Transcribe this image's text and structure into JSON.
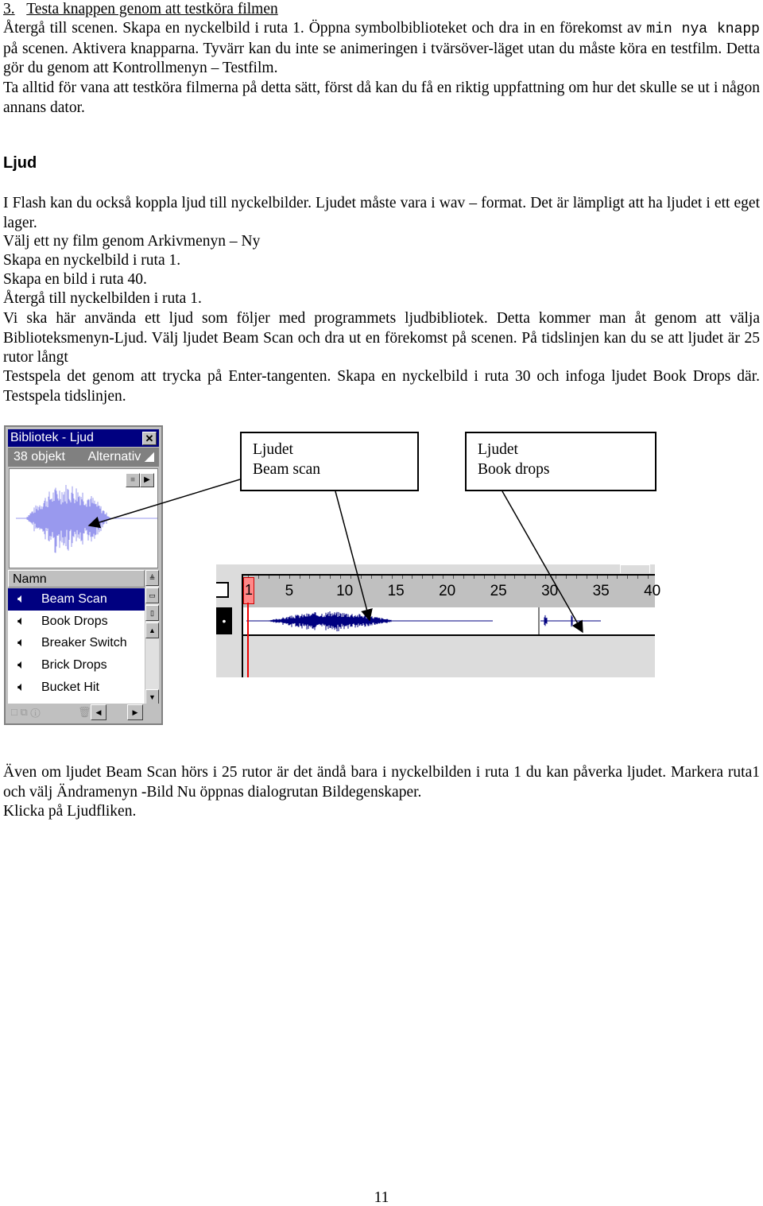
{
  "section": {
    "number": "3.",
    "title": "Testa knappen genom att testköra filmen"
  },
  "intro": {
    "p1_a": "Återgå till scenen. Skapa en nyckelbild i ruta 1. Öppna symbolbiblioteket och dra in en förekomst av",
    "p1_code": "min nya knapp",
    "p1_b": "på scenen. Aktivera knapparna. Tyvärr kan du inte se animeringen i tvärsöver-läget utan du måste köra en testfilm. Detta gör du genom att Kontrollmenyn – Testfilm.",
    "p2": "Ta alltid för vana att testköra filmerna på detta sätt, först då kan du få en riktig uppfattning om hur det skulle se ut i någon annans dator."
  },
  "heading": "Ljud",
  "body": {
    "p1": "I Flash kan du också koppla ljud till nyckelbilder. Ljudet måste vara i wav – format. Det är lämpligt att ha ljudet i ett eget lager.",
    "l1": "Välj ett ny film genom Arkivmenyn – Ny",
    "l2": "Skapa en nyckelbild i ruta 1.",
    "l3": "Skapa en bild i ruta 40.",
    "l4": "Återgå till nyckelbilden i ruta 1.",
    "p2": "Vi ska här använda ett ljud som följer med programmets ljudbibliotek. Detta kommer man åt genom att välja Biblioteksmenyn-Ljud. Välj ljudet Beam Scan och dra ut en förekomst på scenen. På tidslinjen kan du se att ljudet är 25 rutor långt",
    "p3": "Testspela det genom att trycka på Enter-tangenten. Skapa en nyckelbild i ruta 30 och infoga ljudet Book Drops där. Testspela tidslinjen."
  },
  "library": {
    "title": "Bibliotek - Ljud",
    "count": "38 objekt",
    "options": "Alternativ",
    "column": "Namn",
    "items": [
      "Beam Scan",
      "Book Drops",
      "Breaker Switch",
      "Brick Drops",
      "Bucket Hit"
    ],
    "selected": "Beam Scan",
    "waveform_color": "#9999ee"
  },
  "callouts": [
    {
      "line1": "Ljudet",
      "line2": "Beam scan"
    },
    {
      "line1": "Ljudet",
      "line2": "Book drops"
    }
  ],
  "timeline": {
    "current_frame": "1",
    "ticks": [
      "5",
      "10",
      "15",
      "20",
      "25",
      "30",
      "35",
      "40"
    ],
    "waveform_color": "#000080"
  },
  "outro": {
    "p1": "Även om ljudet Beam Scan hörs i 25 rutor är det ändå bara i nyckelbilden i ruta 1 du kan påverka ljudet. Markera ruta1 och välj Ändramenyn  -Bild   Nu öppnas dialogrutan Bildegenskaper.",
    "p2": "Klicka på Ljudfliken."
  },
  "page_number": "11"
}
